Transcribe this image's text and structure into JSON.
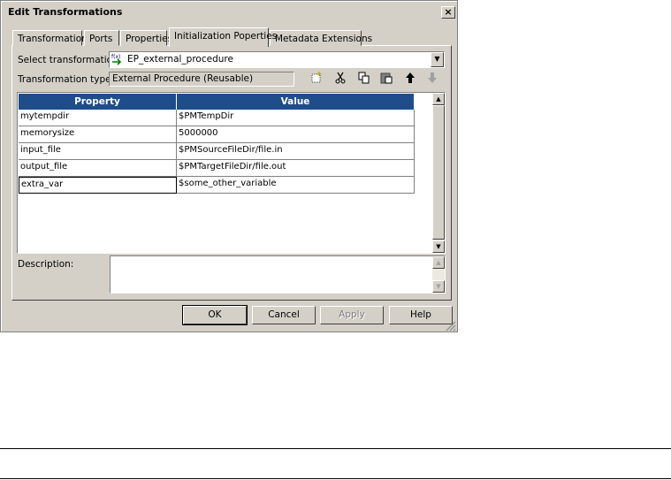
{
  "window": {
    "title": "Edit Transformations",
    "close_label": "×"
  },
  "tabs": [
    {
      "label": "Transformation"
    },
    {
      "label": "Ports"
    },
    {
      "label": "Properties"
    },
    {
      "label": "Initialization Poperties"
    },
    {
      "label": "Metadata Extensions"
    }
  ],
  "active_tab": "Initialization Poperties",
  "select_transformation": {
    "label": "Select transformation:",
    "value": "EP_external_procedure",
    "icon": "external-procedure-icon"
  },
  "transformation_type": {
    "label": "Transformation type:",
    "value": "External Procedure (Reusable)"
  },
  "toolbar": {
    "icons": [
      "new-icon",
      "cut-icon",
      "copy-icon",
      "paste-icon",
      "move-up-icon",
      "move-down-icon"
    ]
  },
  "table": {
    "headers": [
      "Property",
      "Value"
    ],
    "rows": [
      {
        "property": "mytempdir",
        "value": "$PMTempDir"
      },
      {
        "property": "memorysize",
        "value": "5000000"
      },
      {
        "property": "input_file",
        "value": "$PMSourceFileDir/file.in"
      },
      {
        "property": "output_file",
        "value": "$PMTargetFileDir/file.out"
      },
      {
        "property": "extra_var",
        "value": "$some_other_variable"
      }
    ]
  },
  "description": {
    "label": "Description:",
    "value": ""
  },
  "buttons": {
    "ok": "OK",
    "cancel": "Cancel",
    "apply": "Apply",
    "help": "Help"
  },
  "colors": {
    "header_bg": "#1f4d8c",
    "dialog_bg": "#d4d0c8"
  }
}
